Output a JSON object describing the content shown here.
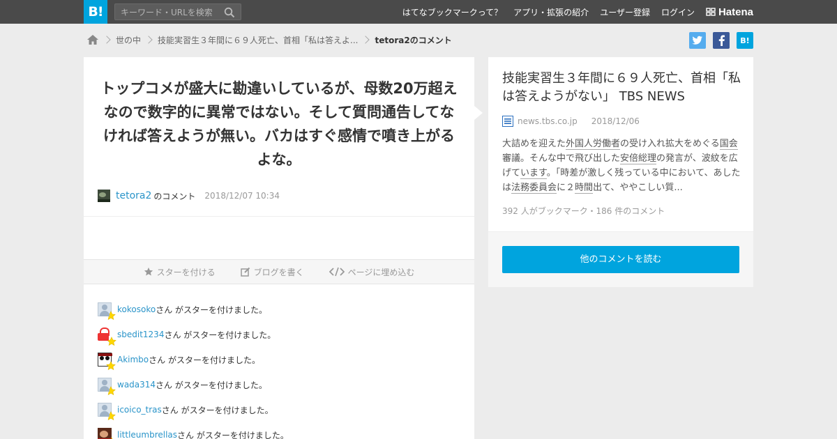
{
  "header": {
    "logo": "B!",
    "search_placeholder": "キーワード・URLを検索",
    "nav": [
      "はてなブックマークって？",
      "アプリ・拡張の紹介",
      "ユーザー登録",
      "ログイン"
    ],
    "brand": "Hatena"
  },
  "breadcrumb": {
    "items": [
      "世の中",
      "技能実習生３年間に６９人死亡、首相「私は答えよ..."
    ],
    "current": "tetora2のコメント"
  },
  "share": {
    "hatena_label": "B!"
  },
  "comment": {
    "text": "トップコメが盛大に勘違いしているが、母数20万超えなので数字的に異常ではない。そして質問通告してなければ答えようが無い。バカはすぐ感情で噴き上がるよな。",
    "user": "tetora2",
    "suffix": "のコメント",
    "timestamp": "2018/12/07 10:34"
  },
  "actions": [
    "スターを付ける",
    "ブログを書く",
    "ページに埋め込む"
  ],
  "stars": {
    "suffix": "さん がスターを付けました。",
    "users": [
      {
        "name": "kokosoko",
        "avatar": "default"
      },
      {
        "name": "sbedit1234",
        "avatar": "lock"
      },
      {
        "name": "Akimbo",
        "avatar": "panda"
      },
      {
        "name": "wada314",
        "avatar": "default"
      },
      {
        "name": "icoico_tras",
        "avatar": "default"
      },
      {
        "name": "littleumbrellas",
        "avatar": "photo"
      }
    ]
  },
  "entry": {
    "title": "技能実習生３年間に６９人死亡、首相「私は答えようがない」 TBS NEWS",
    "site": "news.tbs.co.jp",
    "date": "2018/12/06",
    "excerpt": [
      {
        "t": "大詰めを迎えた",
        "kw": false
      },
      {
        "t": "外国人労働者",
        "kw": true
      },
      {
        "t": "の受け入れ拡大をめぐる",
        "kw": false
      },
      {
        "t": "国会",
        "kw": true
      },
      {
        "t": "審議。そんな中で飛び出した",
        "kw": false
      },
      {
        "t": "安倍総理",
        "kw": true
      },
      {
        "t": "の発言が、波紋を広げて",
        "kw": false
      },
      {
        "t": "います",
        "kw": true
      },
      {
        "t": "。「時差が激しく残っている中において、あしたは",
        "kw": false
      },
      {
        "t": "法務委員会",
        "kw": true
      },
      {
        "t": "に２",
        "kw": false
      },
      {
        "t": "時間",
        "kw": true
      },
      {
        "t": "出て、ややこしい質...",
        "kw": false
      }
    ],
    "counts": "392 人がブックマーク・186 件のコメント",
    "read_button": "他のコメントを読む"
  },
  "colors": {
    "accent": "#00a4de",
    "header_bg": "#4a4a4a",
    "link": "#2a94c9",
    "star": "#ffd700"
  }
}
